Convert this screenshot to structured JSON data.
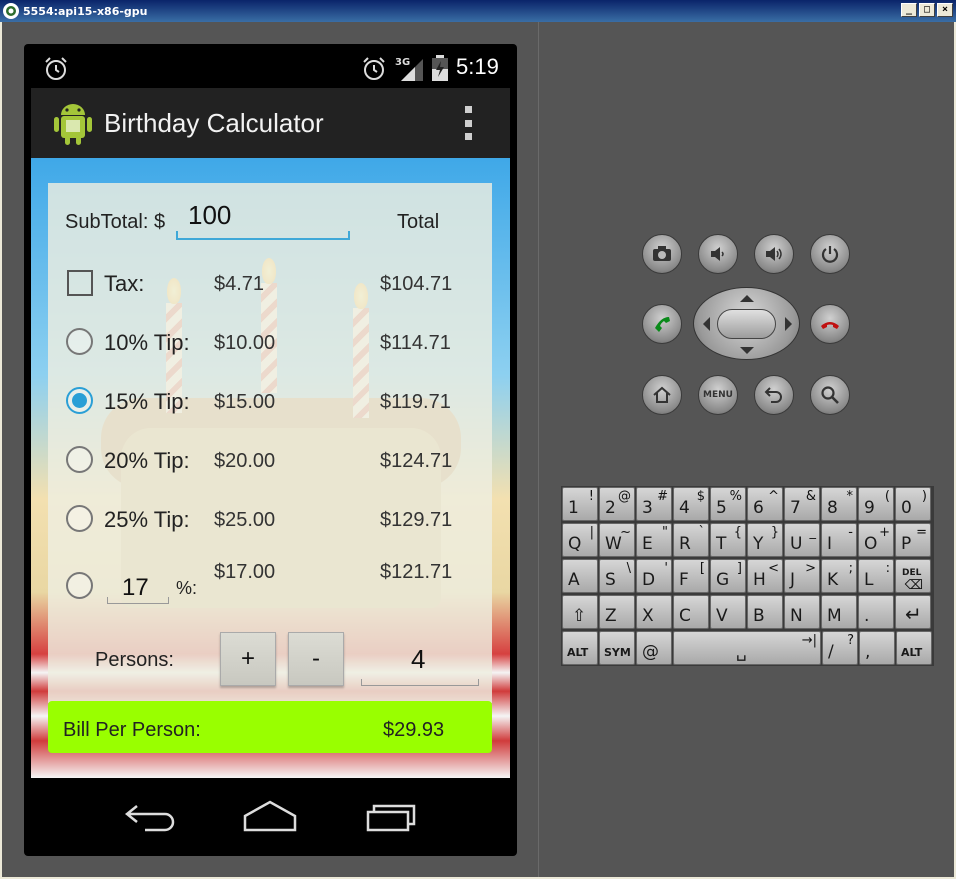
{
  "window": {
    "title": "5554:api15-x86-gpu",
    "minimize": "_",
    "maximize": "□",
    "close": "×"
  },
  "status_bar": {
    "network": "3G",
    "time": "5:19"
  },
  "action_bar": {
    "title": "Birthday Calculator"
  },
  "calculator": {
    "subtotal_label": "SubTotal: $",
    "subtotal_value": "100",
    "total_header": "Total",
    "rows": [
      {
        "label": "Tax:",
        "amount": "$4.71",
        "total": "$104.71",
        "control": "checkbox",
        "checked": false
      },
      {
        "label": "10% Tip:",
        "amount": "$10.00",
        "total": "$114.71",
        "control": "radio",
        "checked": false
      },
      {
        "label": "15% Tip:",
        "amount": "$15.00",
        "total": "$119.71",
        "control": "radio",
        "checked": true
      },
      {
        "label": "20% Tip:",
        "amount": "$20.00",
        "total": "$124.71",
        "control": "radio",
        "checked": false
      },
      {
        "label": "25% Tip:",
        "amount": "$25.00",
        "total": "$129.71",
        "control": "radio",
        "checked": false
      }
    ],
    "custom": {
      "percent_value": "17",
      "percent_label": "%:",
      "amount": "$17.00",
      "total": "$121.71"
    },
    "persons_label": "Persons:",
    "plus_label": "+",
    "minus_label": "-",
    "persons_value": "4",
    "bill_label": "Bill Per Person:",
    "bill_value": "$29.93"
  },
  "emulator_controls": {
    "menu_label": "MENU"
  },
  "keyboard": {
    "rows": [
      [
        {
          "k": "1",
          "a": "!"
        },
        {
          "k": "2",
          "a": "@"
        },
        {
          "k": "3",
          "a": "#"
        },
        {
          "k": "4",
          "a": "$"
        },
        {
          "k": "5",
          "a": "%"
        },
        {
          "k": "6",
          "a": "^"
        },
        {
          "k": "7",
          "a": "&"
        },
        {
          "k": "8",
          "a": "*"
        },
        {
          "k": "9",
          "a": "("
        },
        {
          "k": "0",
          "a": ")"
        }
      ],
      [
        {
          "k": "Q",
          "a": "|"
        },
        {
          "k": "W",
          "a": "~"
        },
        {
          "k": "E",
          "a": "\""
        },
        {
          "k": "R",
          "a": "`"
        },
        {
          "k": "T",
          "a": "{"
        },
        {
          "k": "Y",
          "a": "}"
        },
        {
          "k": "U",
          "a": "_"
        },
        {
          "k": "I",
          "a": "-"
        },
        {
          "k": "O",
          "a": "+"
        },
        {
          "k": "P",
          "a": "="
        }
      ],
      [
        {
          "k": "A",
          "a": ""
        },
        {
          "k": "S",
          "a": "\\"
        },
        {
          "k": "D",
          "a": "'"
        },
        {
          "k": "F",
          "a": "["
        },
        {
          "k": "G",
          "a": "]"
        },
        {
          "k": "H",
          "a": "<"
        },
        {
          "k": "J",
          "a": ">"
        },
        {
          "k": "K",
          "a": ";"
        },
        {
          "k": "L",
          "a": ":"
        },
        {
          "k": "DEL",
          "a": ""
        }
      ],
      [
        {
          "k": "⇧",
          "a": ""
        },
        {
          "k": "Z",
          "a": ""
        },
        {
          "k": "X",
          "a": ""
        },
        {
          "k": "C",
          "a": ""
        },
        {
          "k": "V",
          "a": ""
        },
        {
          "k": "B",
          "a": ""
        },
        {
          "k": "N",
          "a": ""
        },
        {
          "k": "M",
          "a": ""
        },
        {
          "k": ".",
          "a": ""
        },
        {
          "k": "↵",
          "a": ""
        }
      ],
      [
        {
          "k": "ALT",
          "a": ""
        },
        {
          "k": "SYM",
          "a": ""
        },
        {
          "k": "@",
          "a": ""
        },
        {
          "k": "␣",
          "a": "→|"
        },
        {
          "k": "/",
          "a": "?"
        },
        {
          "k": ",",
          "a": ""
        },
        {
          "k": "ALT",
          "a": ""
        }
      ]
    ]
  }
}
